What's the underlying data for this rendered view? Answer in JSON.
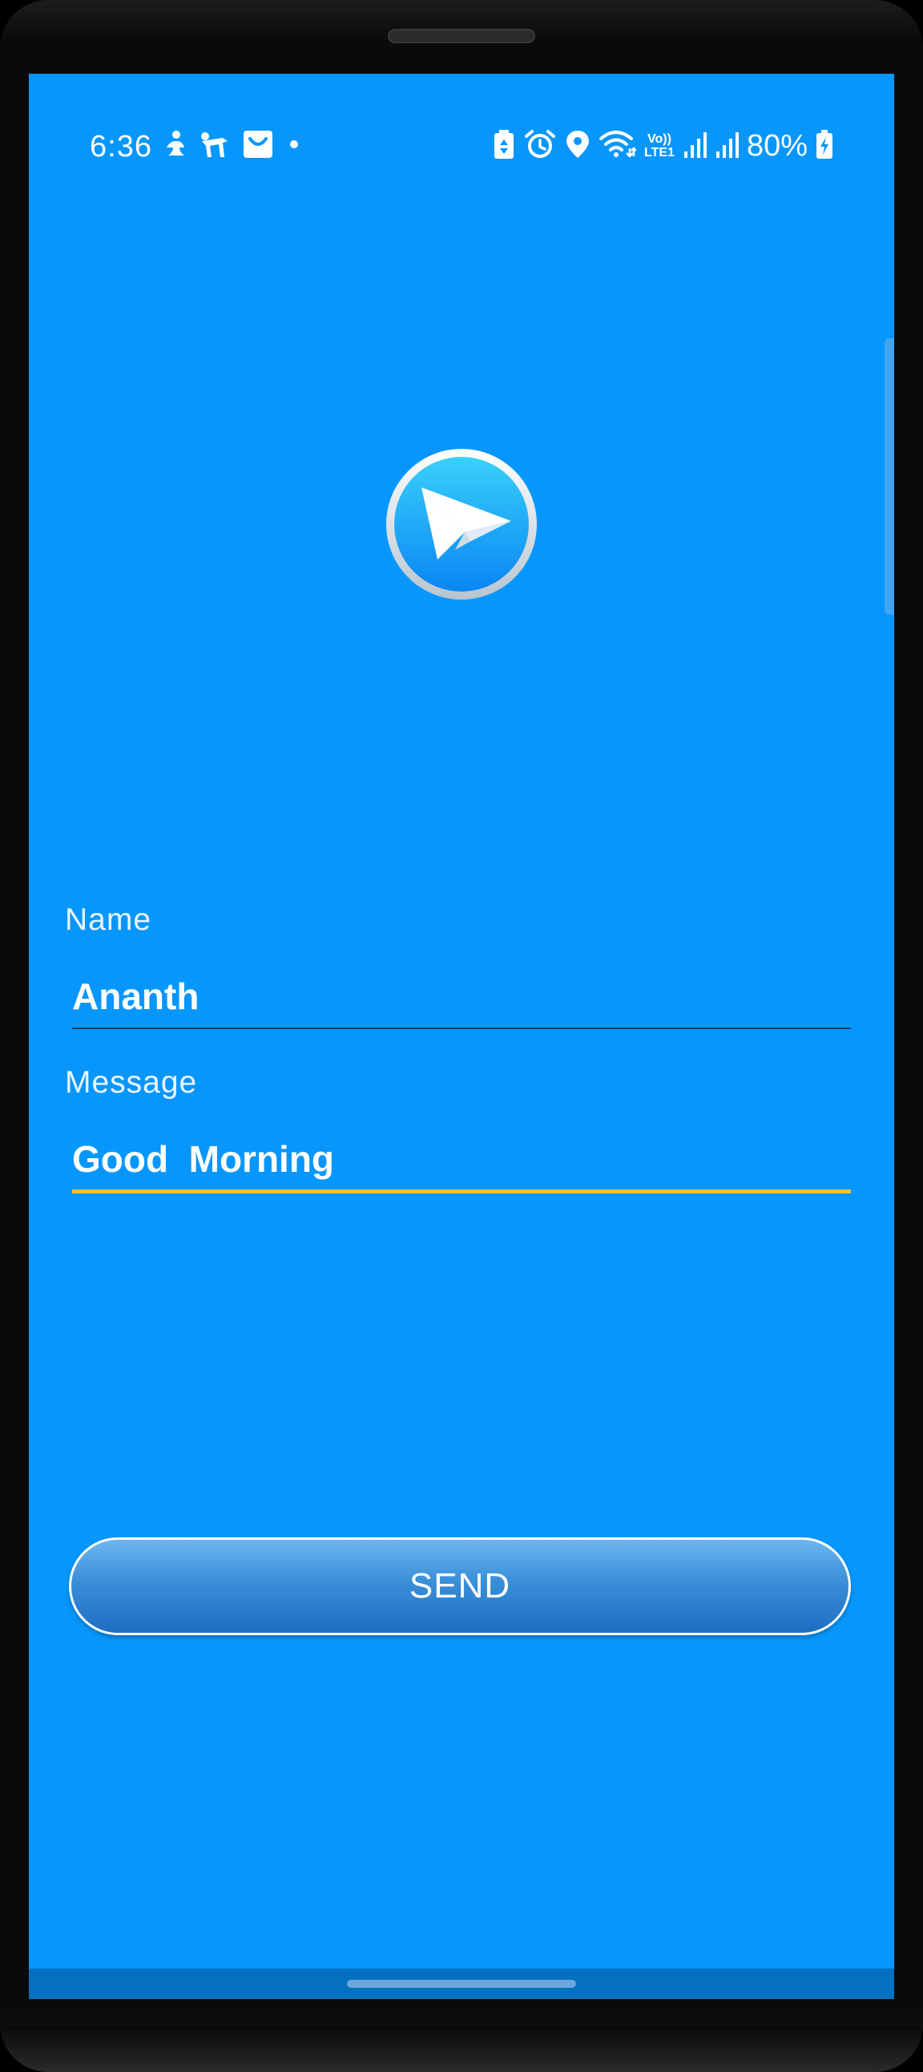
{
  "status_bar": {
    "time": "6:36",
    "battery_percent": "80%",
    "network_label_top": "Vo))",
    "network_label_bottom": "LTE1",
    "left_icons": [
      "accessibility-icon",
      "yoga-icon",
      "shopping-bag-icon",
      "notification-dot-icon"
    ],
    "right_icons": [
      "battery-saver-icon",
      "alarm-icon",
      "location-icon",
      "wifi-icon",
      "signal-icon",
      "signal-icon",
      "battery-charging-icon"
    ]
  },
  "logo": {
    "icon": "paper-plane-icon"
  },
  "form": {
    "name_label": "Name",
    "name_value": "Ananth",
    "message_label": "Message",
    "message_value": "Good  Morning",
    "send_label": "SEND"
  },
  "colors": {
    "background": "#0797FC",
    "focused_underline": "#E8C43A",
    "unfocused_underline": "#0B3F6B",
    "nav_bar": "#0370C0"
  }
}
